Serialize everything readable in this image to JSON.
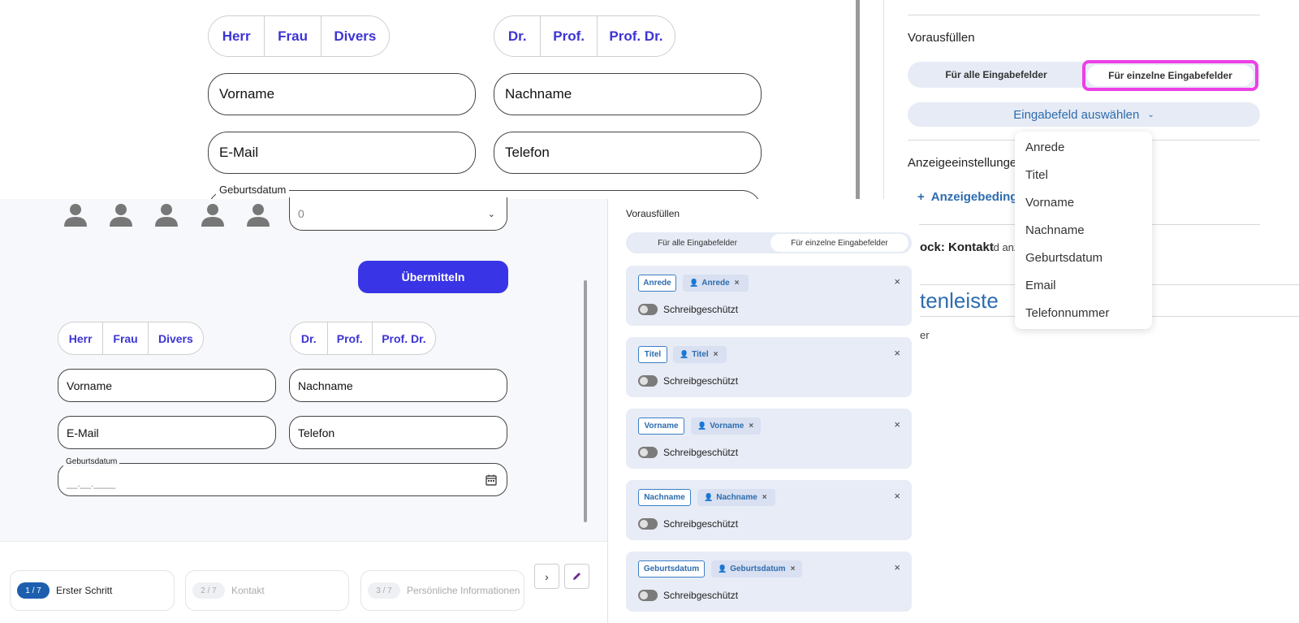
{
  "top_form": {
    "salutation": [
      "Herr",
      "Frau",
      "Divers"
    ],
    "title": [
      "Dr.",
      "Prof.",
      "Prof. Dr."
    ],
    "first_name": "Vorname",
    "last_name": "Nachname",
    "email": "E-Mail",
    "phone": "Telefon",
    "birthdate_label": "Geburtsdatum"
  },
  "right_top": {
    "prefill_heading": "Vorausfüllen",
    "tab_all": "Für alle Eingabefelder",
    "tab_single": "Für einzelne Eingabefelder",
    "field_select": "Eingabefeld auswählen",
    "display_settings": "Anzeigeeinstellunge",
    "display_condition": "Anzeigebeding",
    "block_label": "ock: Kontakt",
    "id_label": "Id anz",
    "sidebar_text": "tenleiste",
    "small_text": "er",
    "dropdown_options": [
      "Anrede",
      "Titel",
      "Vorname",
      "Nachname",
      "Geburtsdatum",
      "Email",
      "Telefonnummer"
    ]
  },
  "bottom_form": {
    "select_value": "0",
    "submit": "Übermitteln",
    "salutation": [
      "Herr",
      "Frau",
      "Divers"
    ],
    "title": [
      "Dr.",
      "Prof.",
      "Prof. Dr."
    ],
    "first_name": "Vorname",
    "last_name": "Nachname",
    "email": "E-Mail",
    "phone": "Telefon",
    "birthdate_label": "Geburtsdatum",
    "birthdate_placeholder": "__.__.____"
  },
  "steps": [
    {
      "badge": "1 / 7",
      "label": "Erster Schritt"
    },
    {
      "badge": "2 / 7",
      "label": "Kontakt"
    },
    {
      "badge": "3 / 7",
      "label": "Persönliche Informationen"
    }
  ],
  "prefill_panel": {
    "heading": "Vorausfüllen",
    "tab_all": "Für alle Eingabefelder",
    "tab_single": "Für einzelne Eingabefelder",
    "readonly_label": "Schreibgeschützt",
    "cards": [
      {
        "field": "Anrede",
        "source": "Anrede"
      },
      {
        "field": "Titel",
        "source": "Titel"
      },
      {
        "field": "Vorname",
        "source": "Vorname"
      },
      {
        "field": "Nachname",
        "source": "Nachname"
      },
      {
        "field": "Geburtsdatum",
        "source": "Geburtsdatum"
      }
    ]
  },
  "colors": {
    "accent": "#3c34d4",
    "highlight": "#ee3fe6",
    "link": "#2d6cae",
    "submit": "#3935e6"
  }
}
